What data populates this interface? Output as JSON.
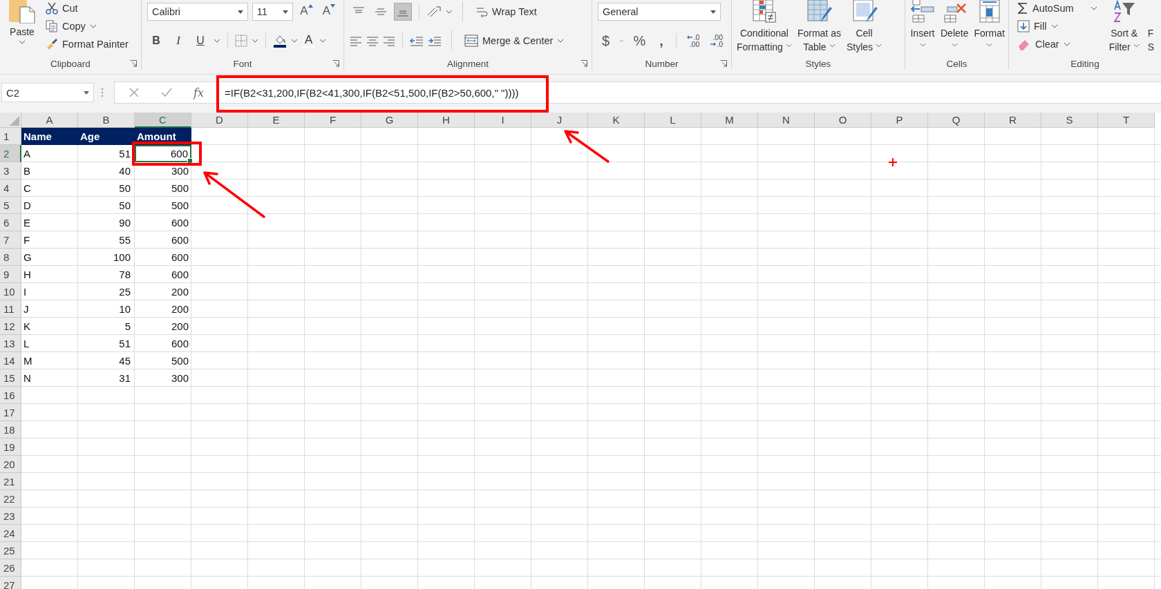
{
  "ribbon": {
    "clipboard": {
      "label": "Clipboard",
      "paste": "Paste",
      "cut": "Cut",
      "copy": "Copy",
      "format_painter": "Format Painter"
    },
    "font": {
      "label": "Font",
      "family": "Calibri",
      "size": "11",
      "grow": "A",
      "shrink": "A",
      "bold": "B",
      "italic": "I",
      "underline": "U",
      "font_color": "A"
    },
    "alignment": {
      "label": "Alignment",
      "vertical": [
        {
          "kind": "top",
          "selected": false
        },
        {
          "kind": "middle",
          "selected": false
        },
        {
          "kind": "bottom",
          "selected": true
        }
      ],
      "wrap_text": "Wrap Text",
      "merge_center": "Merge & Center"
    },
    "number": {
      "label": "Number",
      "format": "General",
      "currency": "$",
      "percent": "%",
      "comma": ",",
      "decimals": [
        {
          "kind": "increase",
          "top": ".0",
          "bottom": ".00"
        },
        {
          "kind": "decrease",
          "top": ".00",
          "bottom": ".0"
        }
      ]
    },
    "styles": {
      "label": "Styles",
      "buttons": [
        {
          "kind": "conditional",
          "lines": [
            "Conditional",
            "Formatting"
          ]
        },
        {
          "kind": "table",
          "lines": [
            "Format as",
            "Table"
          ]
        },
        {
          "kind": "cell",
          "lines": [
            "Cell",
            "Styles"
          ]
        }
      ]
    },
    "cells": {
      "label": "Cells",
      "buttons": [
        {
          "kind": "insert",
          "label": "Insert"
        },
        {
          "kind": "delete",
          "label": "Delete"
        },
        {
          "kind": "format",
          "label": "Format"
        }
      ]
    },
    "editing": {
      "label": "Editing",
      "autosum": "AutoSum",
      "fill": "Fill",
      "clear": "Clear",
      "sort_filter": [
        "Sort &",
        "Filter"
      ],
      "find_select": [
        "F",
        "S"
      ]
    }
  },
  "formula_bar": {
    "name_box": "C2",
    "fx": "fx",
    "formula": "=IF(B2<31,200,IF(B2<41,300,IF(B2<51,500,IF(B2>50,600,\" \"))))"
  },
  "sheet": {
    "columns": [
      {
        "label": "A",
        "selected": false
      },
      {
        "label": "B",
        "selected": false
      },
      {
        "label": "C",
        "selected": true
      },
      {
        "label": "D",
        "selected": false
      },
      {
        "label": "E",
        "selected": false
      },
      {
        "label": "F",
        "selected": false
      },
      {
        "label": "G",
        "selected": false
      },
      {
        "label": "H",
        "selected": false
      },
      {
        "label": "I",
        "selected": false
      },
      {
        "label": "J",
        "selected": false
      },
      {
        "label": "K",
        "selected": false
      },
      {
        "label": "L",
        "selected": false
      },
      {
        "label": "M",
        "selected": false
      },
      {
        "label": "N",
        "selected": false
      },
      {
        "label": "O",
        "selected": false
      },
      {
        "label": "P",
        "selected": false
      },
      {
        "label": "Q",
        "selected": false
      },
      {
        "label": "R",
        "selected": false
      },
      {
        "label": "S",
        "selected": false
      },
      {
        "label": "T",
        "selected": false
      }
    ],
    "row_headers": [
      {
        "label": "1",
        "selected": false
      },
      {
        "label": "2",
        "selected": true
      },
      {
        "label": "3",
        "selected": false
      },
      {
        "label": "4",
        "selected": false
      },
      {
        "label": "5",
        "selected": false
      },
      {
        "label": "6",
        "selected": false
      },
      {
        "label": "7",
        "selected": false
      },
      {
        "label": "8",
        "selected": false
      },
      {
        "label": "9",
        "selected": false
      },
      {
        "label": "10",
        "selected": false
      },
      {
        "label": "11",
        "selected": false
      },
      {
        "label": "12",
        "selected": false
      },
      {
        "label": "13",
        "selected": false
      },
      {
        "label": "14",
        "selected": false
      },
      {
        "label": "15",
        "selected": false
      },
      {
        "label": "16",
        "selected": false
      },
      {
        "label": "17",
        "selected": false
      },
      {
        "label": "18",
        "selected": false
      },
      {
        "label": "19",
        "selected": false
      },
      {
        "label": "20",
        "selected": false
      },
      {
        "label": "21",
        "selected": false
      },
      {
        "label": "22",
        "selected": false
      },
      {
        "label": "23",
        "selected": false
      },
      {
        "label": "24",
        "selected": false
      },
      {
        "label": "25",
        "selected": false
      },
      {
        "label": "26",
        "selected": false
      },
      {
        "label": "27",
        "selected": false
      }
    ],
    "header": [
      "Name",
      "Age",
      "Amount"
    ],
    "rows": [
      {
        "cells": [
          "A",
          "51",
          "600"
        ],
        "active": true
      },
      {
        "cells": [
          "B",
          "40",
          "300"
        ],
        "active": false
      },
      {
        "cells": [
          "C",
          "50",
          "500"
        ],
        "active": false
      },
      {
        "cells": [
          "D",
          "50",
          "500"
        ],
        "active": false
      },
      {
        "cells": [
          "E",
          "90",
          "600"
        ],
        "active": false
      },
      {
        "cells": [
          "F",
          "55",
          "600"
        ],
        "active": false
      },
      {
        "cells": [
          "G",
          "100",
          "600"
        ],
        "active": false
      },
      {
        "cells": [
          "H",
          "78",
          "600"
        ],
        "active": false
      },
      {
        "cells": [
          "I",
          "25",
          "200"
        ],
        "active": false
      },
      {
        "cells": [
          "J",
          "10",
          "200"
        ],
        "active": false
      },
      {
        "cells": [
          "K",
          "5",
          "200"
        ],
        "active": false
      },
      {
        "cells": [
          "L",
          "51",
          "600"
        ],
        "active": false
      },
      {
        "cells": [
          "M",
          "45",
          "500"
        ],
        "active": false
      },
      {
        "cells": [
          "N",
          "31",
          "300"
        ],
        "active": false
      }
    ]
  }
}
